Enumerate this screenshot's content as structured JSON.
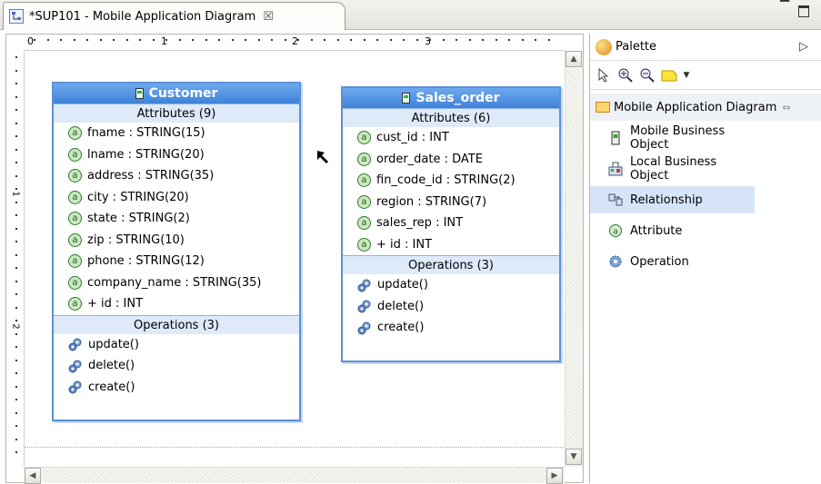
{
  "editor": {
    "tab_title": "*SUP101 - Mobile Application Diagram",
    "close_glyph": "☒"
  },
  "ruler": {
    "h_labels": [
      "0",
      "1",
      "2",
      "3"
    ],
    "v_labels": [
      "1",
      "2"
    ]
  },
  "diagram": {
    "customer": {
      "name": "Customer",
      "attributes_header": "Attributes (9)",
      "attributes": [
        "fname : STRING(15)",
        "lname : STRING(20)",
        "address : STRING(35)",
        "city : STRING(20)",
        "state : STRING(2)",
        "zip : STRING(10)",
        "phone : STRING(12)",
        "company_name : STRING(35)",
        "+ id : INT"
      ],
      "operations_header": "Operations (3)",
      "operations": [
        "update()",
        "delete()",
        "create()"
      ]
    },
    "sales_order": {
      "name": "Sales_order",
      "attributes_header": "Attributes (6)",
      "attributes": [
        "cust_id : INT",
        "order_date : DATE",
        "fin_code_id : STRING(2)",
        "region : STRING(7)",
        "sales_rep : INT",
        "+ id : INT"
      ],
      "operations_header": "Operations (3)",
      "operations": [
        "update()",
        "delete()",
        "create()"
      ]
    }
  },
  "palette": {
    "title": "Palette",
    "drawer_label": "Mobile Application Diagram",
    "items": [
      {
        "label": "Mobile Business Object",
        "icon": "mobile-business-object-icon"
      },
      {
        "label": "Local Business Object",
        "icon": "local-business-object-icon"
      },
      {
        "label": "Relationship",
        "icon": "relationship-icon",
        "selected": true
      },
      {
        "label": "Attribute",
        "icon": "attribute-icon"
      },
      {
        "label": "Operation",
        "icon": "operation-icon"
      }
    ]
  },
  "colors": {
    "class_header": "#3f82d8",
    "section_bg": "#deeafa",
    "selected_item": "#d6e4f8"
  }
}
